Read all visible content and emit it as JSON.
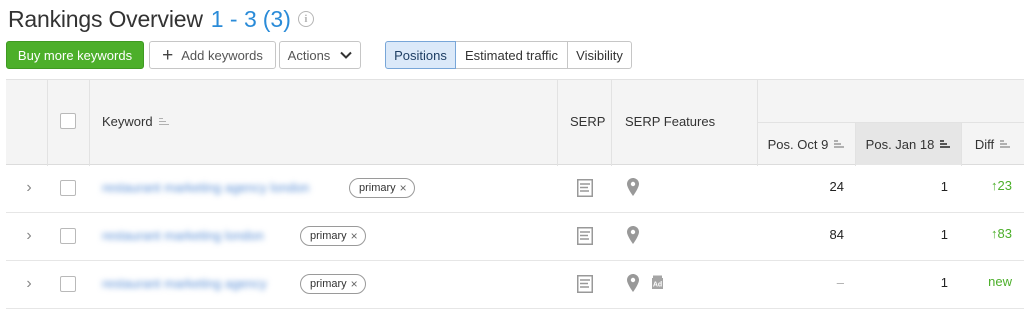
{
  "header": {
    "title": "Rankings Overview",
    "range": "1 - 3",
    "count": "(3)",
    "info_glyph": "i"
  },
  "toolbar": {
    "buy_label": "Buy more keywords",
    "add_label": "Add keywords",
    "add_glyph": "+",
    "actions_label": "Actions",
    "actions_glyph": "⌄",
    "segments": [
      {
        "label": "Positions",
        "active": true
      },
      {
        "label": "Estimated traffic",
        "active": false
      },
      {
        "label": "Visibility",
        "active": false
      }
    ]
  },
  "table": {
    "columns": {
      "keyword": "Keyword",
      "serp": "SERP",
      "serp_features": "SERP Features",
      "pos_oct": "Pos. Oct 9",
      "pos_jan": "Pos. Jan 18",
      "diff": "Diff"
    },
    "rows": [
      {
        "keyword": "restaurant marketing agency london",
        "tag": "primary",
        "tag_x": "×",
        "pos_oct": "24",
        "pos_jan": "1",
        "diff": "↑23",
        "features": [
          "pin-icon"
        ],
        "expand": "›"
      },
      {
        "keyword": "restaurant marketing london",
        "tag": "primary",
        "tag_x": "×",
        "pos_oct": "84",
        "pos_jan": "1",
        "diff": "↑83",
        "features": [
          "pin-icon"
        ],
        "expand": "›"
      },
      {
        "keyword": "restaurant marketing agency",
        "tag": "primary",
        "tag_x": "×",
        "pos_oct": "–",
        "pos_jan": "1",
        "diff": "new",
        "features": [
          "pin-icon",
          "ad-icon"
        ],
        "expand": "›"
      }
    ]
  },
  "colors": {
    "accent_blue": "#2a8bd8",
    "buy_green": "#4caf2a",
    "positive_green": "#4caf2a",
    "active_segment_bg": "#dbe9f9"
  }
}
